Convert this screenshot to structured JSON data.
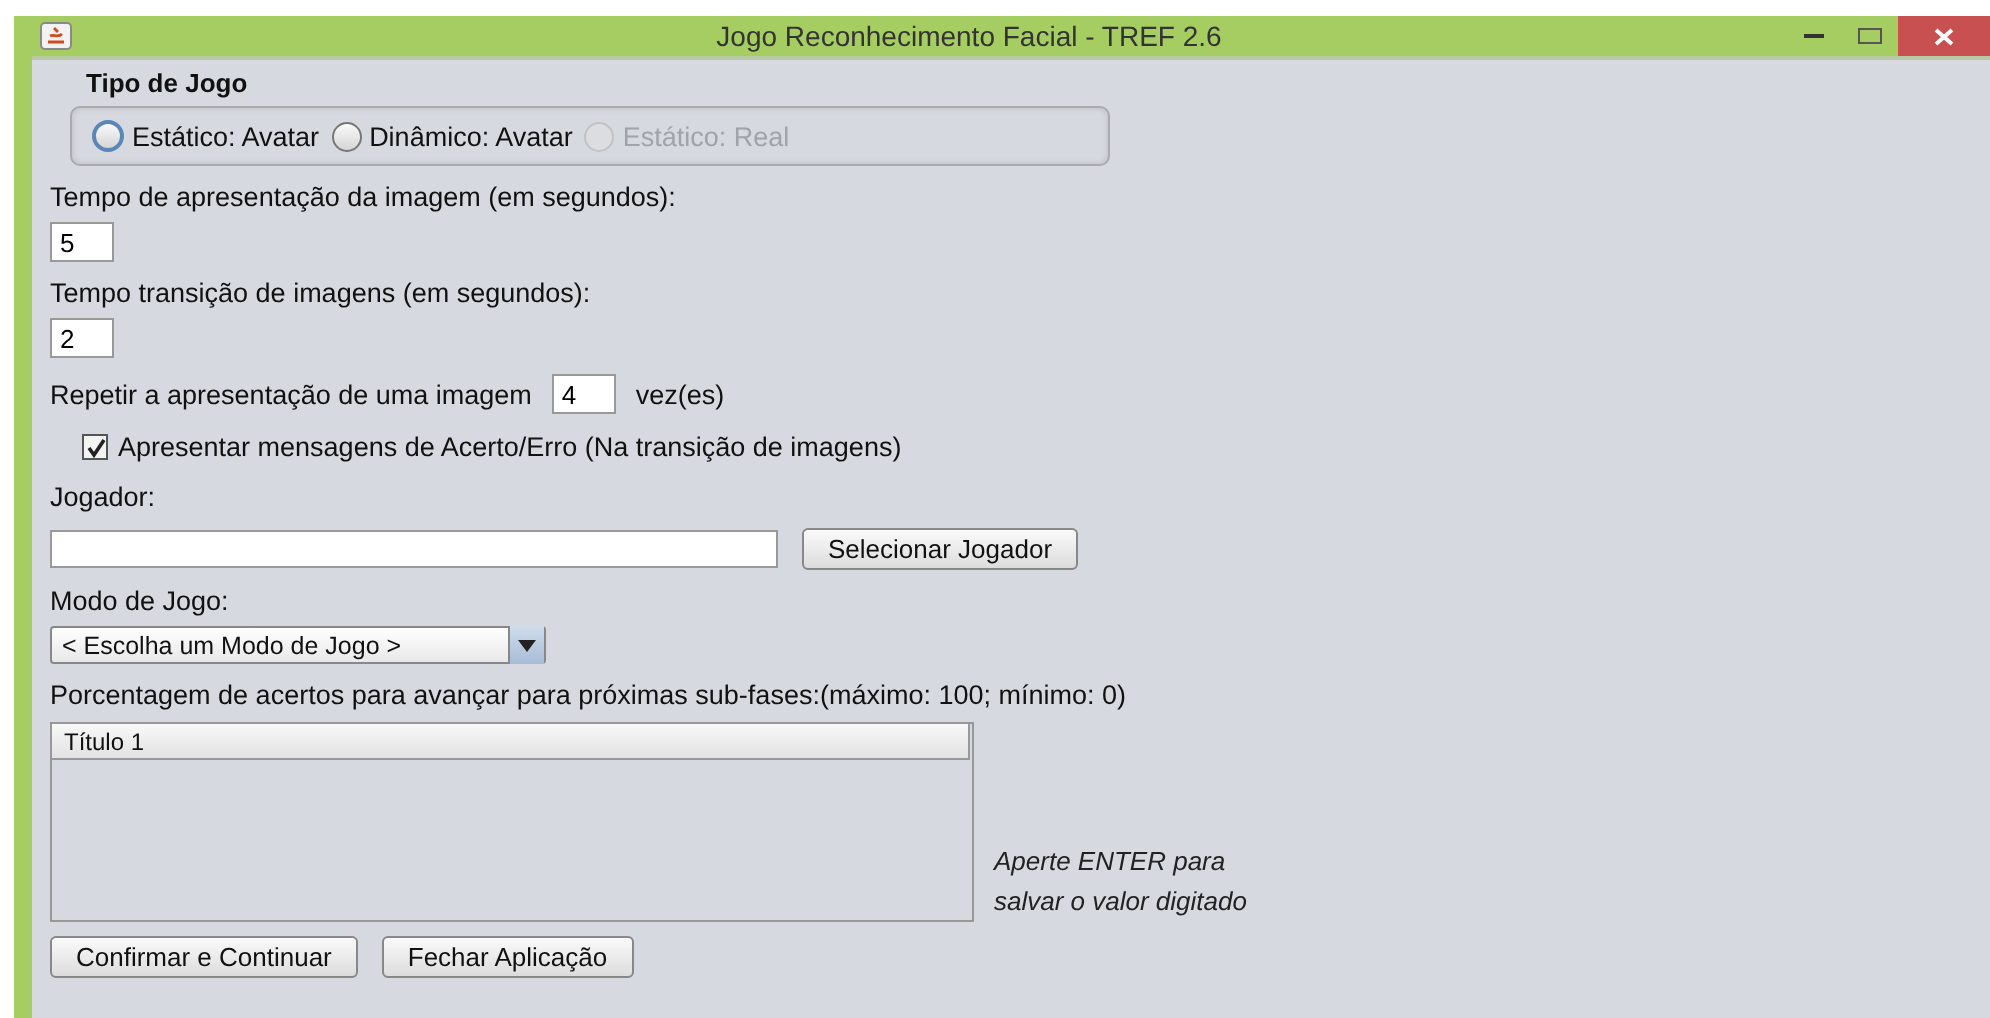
{
  "window": {
    "title": "Jogo Reconhecimento Facial - TREF 2.6"
  },
  "game_type": {
    "label": "Tipo de Jogo",
    "options": [
      {
        "label": "Estático: Avatar",
        "selected": false,
        "disabled": false,
        "focused": true
      },
      {
        "label": "Dinâmico: Avatar",
        "selected": false,
        "disabled": false,
        "focused": false
      },
      {
        "label": "Estático: Real",
        "selected": false,
        "disabled": true,
        "focused": false
      }
    ]
  },
  "display_time": {
    "label": "Tempo de apresentação da imagem (em segundos):",
    "value": "5"
  },
  "transition_time": {
    "label": "Tempo transição de imagens (em segundos):",
    "value": "2"
  },
  "repeat": {
    "label": "Repetir a apresentação de uma imagem",
    "value": "4",
    "suffix": "vez(es)"
  },
  "show_messages": {
    "label": "Apresentar mensagens de Acerto/Erro (Na transição de imagens)",
    "checked": true
  },
  "player": {
    "label": "Jogador:",
    "button": "Selecionar Jogador"
  },
  "mode": {
    "label": "Modo de Jogo:",
    "value": "< Escolha um Modo de Jogo >"
  },
  "percentage": {
    "label": "Porcentagem de acertos para avançar para próximas sub-fases:(máximo: 100; mínimo: 0)",
    "columns": [
      "Título 1"
    ],
    "hint": [
      "Aperte ENTER para",
      "salvar o valor digitado"
    ]
  },
  "buttons": [
    "Confirmar e Continuar",
    "Fechar Aplicação"
  ]
}
